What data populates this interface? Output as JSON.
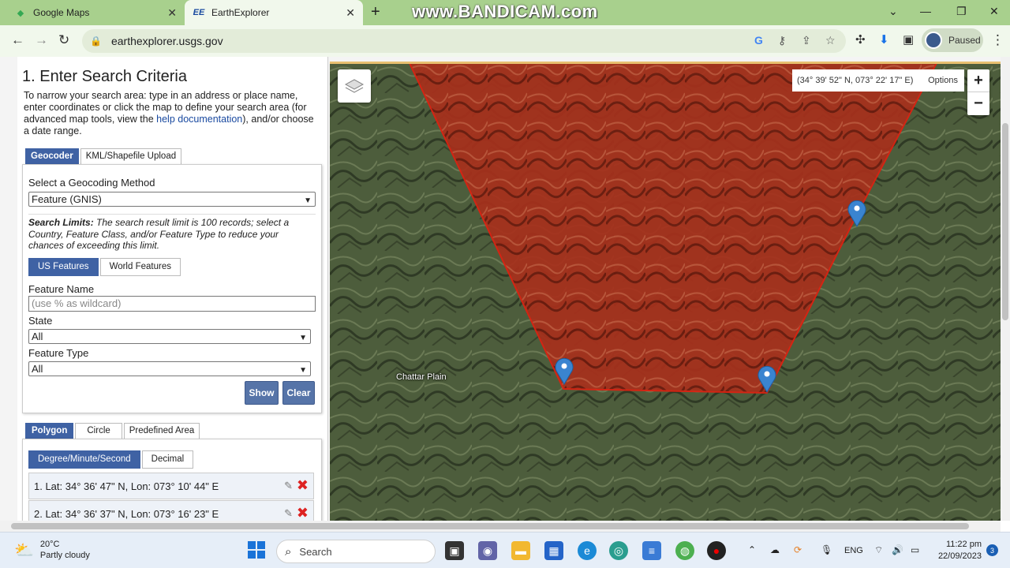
{
  "browser": {
    "tabs": [
      {
        "label": "Google Maps",
        "active": false
      },
      {
        "label": "EarthExplorer",
        "active": true
      }
    ],
    "watermark": "www.BANDICAM.com",
    "url": "earthexplorer.usgs.gov",
    "profile_status": "Paused"
  },
  "panel": {
    "title": "1. Enter Search Criteria",
    "intro_before_link": "To narrow your search area: type in an address or place name, enter coordinates or click the map to define your search area (for advanced map tools, view the ",
    "intro_link": "help documentation",
    "intro_after_link": "), and/or choose a date range.",
    "tabs": [
      "Geocoder",
      "KML/Shapefile Upload"
    ],
    "geocoding_label": "Select a Geocoding Method",
    "geocoding_value": "Feature (GNIS)",
    "limits_bold": "Search Limits:",
    "limits_text": " The search result limit is 100 records; select a Country, Feature Class, and/or Feature Type to reduce your chances of exceeding this limit.",
    "feature_tabs": [
      "US Features",
      "World Features"
    ],
    "feature_name_label": "Feature Name",
    "feature_name_placeholder": "(use % as wildcard)",
    "state_label": "State",
    "state_value": "All",
    "feature_type_label": "Feature Type",
    "feature_type_value": "All",
    "show_label": "Show",
    "clear_label": "Clear",
    "area_tabs": [
      "Polygon",
      "Circle",
      "Predefined Area"
    ],
    "format_tabs": [
      "Degree/Minute/Second",
      "Decimal"
    ],
    "coords": [
      "1.   Lat: 34° 36' 47\" N, Lon: 073° 10' 44\" E",
      "2.   Lat: 34° 36' 37\" N, Lon: 073° 16' 23\" E"
    ]
  },
  "map": {
    "cursor_coords": "(34° 39' 52\" N, 073° 22' 17\" E)",
    "options_label": "Options",
    "zoom_in": "+",
    "zoom_out": "−",
    "place_label": "Chattar Plain",
    "polygon_color": "#b02010"
  },
  "taskbar": {
    "temperature": "20°C",
    "weather": "Partly cloudy",
    "search_label": "Search",
    "language": "ENG",
    "time": "11:22 pm",
    "date": "22/09/2023",
    "notifications": "3"
  }
}
